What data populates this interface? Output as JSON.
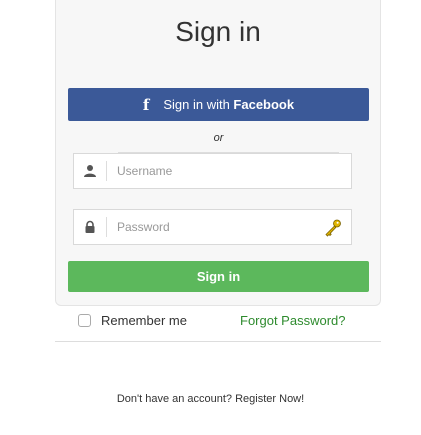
{
  "login": {
    "title": "Sign in",
    "facebook_button": {
      "prefix": "Sign in with ",
      "brand": "Facebook",
      "icon": "facebook-icon"
    },
    "separator": "or",
    "username": {
      "placeholder": "Username",
      "value": "",
      "icon": "user-icon"
    },
    "password": {
      "placeholder": "Password",
      "value": "",
      "icon": "lock-icon",
      "trailing_icon": "key-icon"
    },
    "submit_label": "Sign in",
    "remember_label": "Remember me",
    "remember_checked": false,
    "forgot_label": "Forgot Password?",
    "register_prompt": "Don't have an account? ",
    "register_link": "Register Now!"
  },
  "colors": {
    "facebook": "#3b5998",
    "submit": "#5cb85c",
    "forgot_link": "#2e8b2e",
    "card_bg": "#f7f7f7"
  }
}
